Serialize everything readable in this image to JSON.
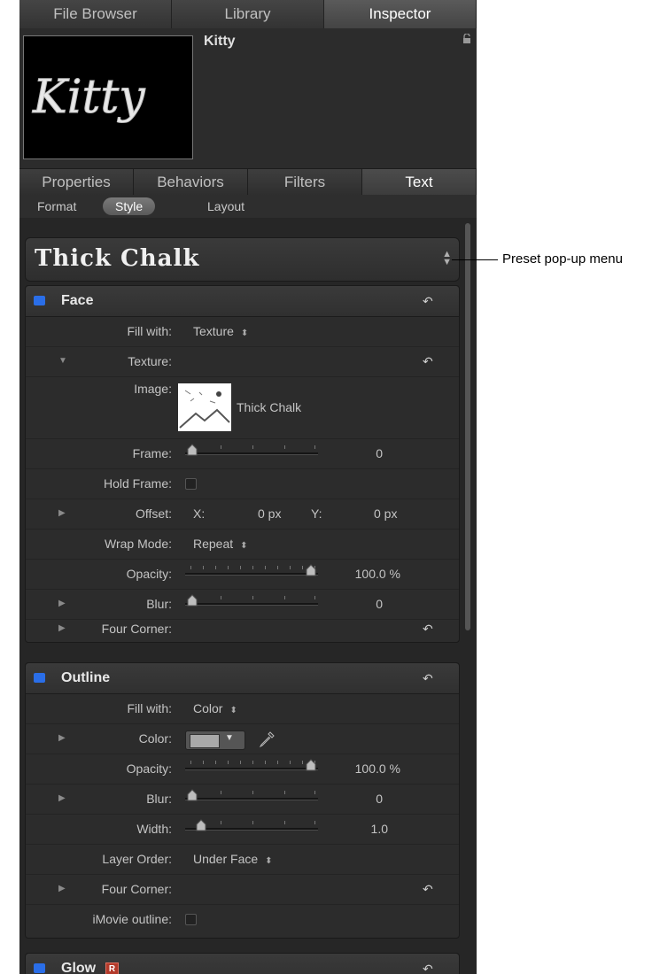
{
  "browser_tabs": [
    "File Browser",
    "Library",
    "Inspector"
  ],
  "preview": {
    "object_name": "Kitty",
    "thumbnail_text": "Kitty"
  },
  "inspector_tabs": [
    "Properties",
    "Behaviors",
    "Filters",
    "Text"
  ],
  "sub_tabs": [
    "Format",
    "Style",
    "Layout"
  ],
  "preset": {
    "name": "Thick Chalk"
  },
  "face": {
    "title": "Face",
    "fill_with_label": "Fill with:",
    "fill_with_value": "Texture",
    "texture_label": "Texture:",
    "image_label": "Image:",
    "image_name": "Thick Chalk",
    "frame_label": "Frame:",
    "frame_value": "0",
    "hold_frame_label": "Hold Frame:",
    "offset_label": "Offset:",
    "offset_x_label": "X:",
    "offset_x_value": "0 px",
    "offset_y_label": "Y:",
    "offset_y_value": "0 px",
    "wrap_mode_label": "Wrap Mode:",
    "wrap_mode_value": "Repeat",
    "opacity_label": "Opacity:",
    "opacity_value": "100.0 %",
    "blur_label": "Blur:",
    "blur_value": "0",
    "four_corner_label": "Four Corner:"
  },
  "outline": {
    "title": "Outline",
    "fill_with_label": "Fill with:",
    "fill_with_value": "Color",
    "color_label": "Color:",
    "color_swatch": "#a9a9a9",
    "opacity_label": "Opacity:",
    "opacity_value": "100.0 %",
    "blur_label": "Blur:",
    "blur_value": "0",
    "width_label": "Width:",
    "width_value": "1.0",
    "layer_order_label": "Layer Order:",
    "layer_order_value": "Under Face",
    "four_corner_label": "Four Corner:",
    "imovie_outline_label": "iMovie outline:"
  },
  "glow": {
    "title": "Glow",
    "badge": "R"
  },
  "callout": {
    "text": "Preset pop-up menu"
  },
  "colors": {
    "enable_blue": "#2a6ee8",
    "panel_bg": "#2a2a2a"
  }
}
